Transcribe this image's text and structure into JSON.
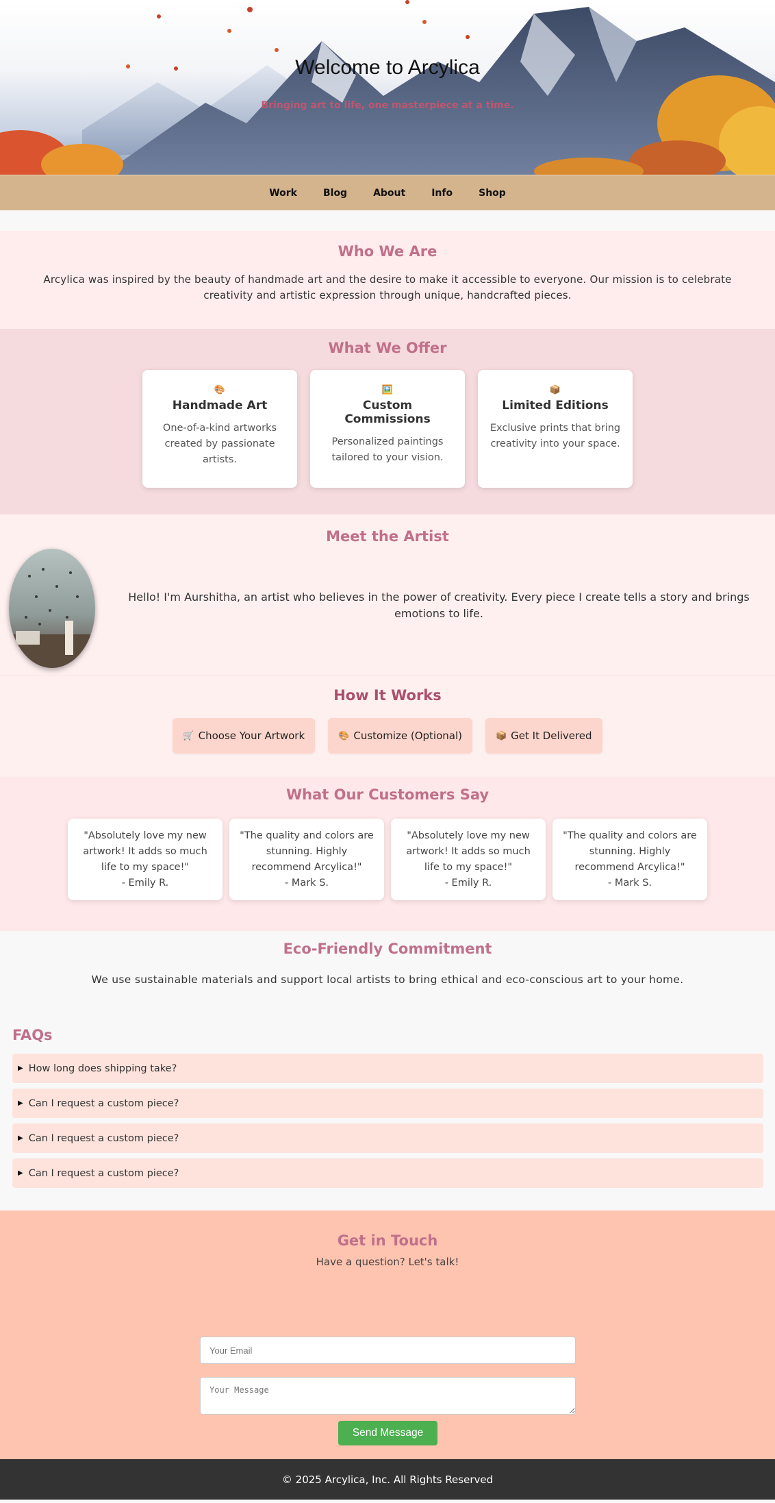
{
  "hero": {
    "title": "Welcome to Arcylica",
    "subtitle": "Bringing art to life, one masterpiece at a time."
  },
  "nav": {
    "items": [
      "Work",
      "Blog",
      "About",
      "Info",
      "Shop"
    ]
  },
  "who": {
    "heading": "Who We Are",
    "text": "Arcylica was inspired by the beauty of handmade art and the desire to make it accessible to everyone. Our mission is to celebrate creativity and artistic expression through unique, handcrafted pieces."
  },
  "offer": {
    "heading": "What We Offer",
    "cards": [
      {
        "icon": "🎨",
        "title": "Handmade Art",
        "text": "One-of-a-kind artworks created by passionate artists."
      },
      {
        "icon": "🖼️",
        "title": "Custom Commissions",
        "text": "Personalized paintings tailored to your vision."
      },
      {
        "icon": "📦",
        "title": "Limited Editions",
        "text": "Exclusive prints that bring creativity into your space."
      }
    ]
  },
  "artist": {
    "heading": "Meet the Artist",
    "bio": "Hello! I'm Aurshitha, an artist who believes in the power of creativity. Every piece I create tells a story and brings emotions to life."
  },
  "how": {
    "heading": "How It Works",
    "steps": [
      {
        "icon": "🛒",
        "label": "Choose Your Artwork"
      },
      {
        "icon": "🎨",
        "label": "Customize (Optional)"
      },
      {
        "icon": "📦",
        "label": "Get It Delivered"
      }
    ]
  },
  "testimonials": {
    "heading": "What Our Customers Say",
    "items": [
      {
        "quote": "\"Absolutely love my new artwork! It adds so much life to my space!\"",
        "author": "- Emily R."
      },
      {
        "quote": "\"The quality and colors are stunning. Highly recommend Arcylica!\"",
        "author": "- Mark S."
      },
      {
        "quote": "\"Absolutely love my new artwork! It adds so much life to my space!\"",
        "author": "- Emily R."
      },
      {
        "quote": "\"The quality and colors are stunning. Highly recommend Arcylica!\"",
        "author": "- Mark S."
      }
    ]
  },
  "eco": {
    "heading": "Eco-Friendly Commitment",
    "text": "We use sustainable materials and support local artists to bring ethical and eco-conscious art to your home."
  },
  "faq": {
    "heading": "FAQs",
    "items": [
      "How long does shipping take?",
      "Can I request a custom piece?",
      "Can I request a custom piece?",
      "Can I request a custom piece?"
    ]
  },
  "contact": {
    "heading": "Get in Touch",
    "subtitle": "Have a question? Let's talk!",
    "email_placeholder": "Your Email",
    "message_placeholder": "Your Message",
    "send_label": "Send Message"
  },
  "footer": {
    "text": "© 2025 Arcylica, Inc. All Rights Reserved"
  },
  "colors": {
    "nav_bg": "#d4b48d",
    "accent_pink": "#c0708a",
    "contact_bg": "#ffc4b0",
    "send_button": "#4caf50",
    "footer_bg": "#333333"
  }
}
